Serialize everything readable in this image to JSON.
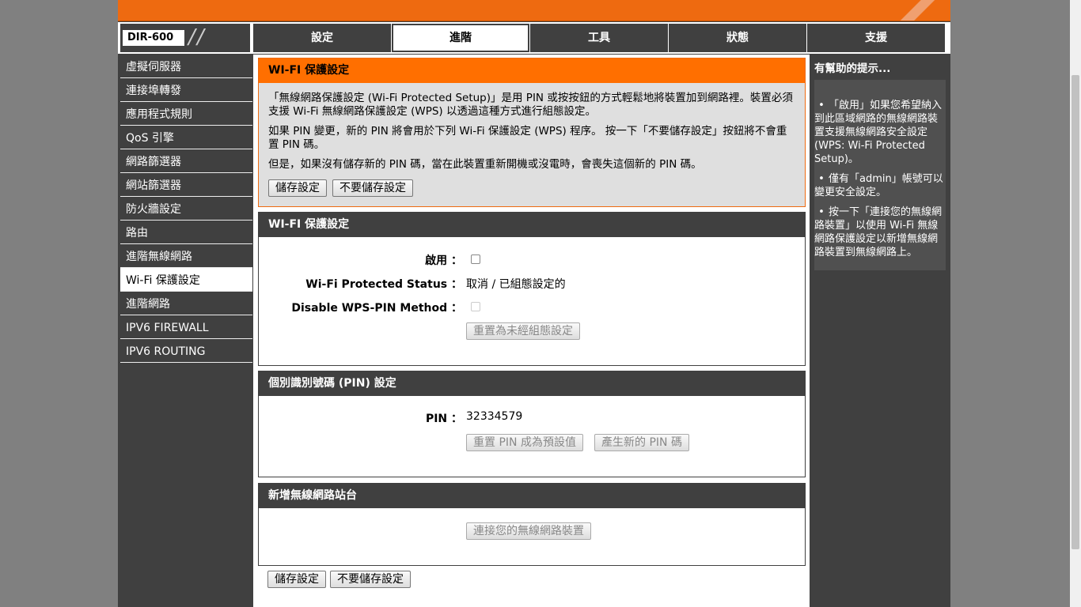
{
  "model": "DIR-600",
  "tabs": [
    {
      "label": "設定",
      "active": false
    },
    {
      "label": "進階",
      "active": true
    },
    {
      "label": "工具",
      "active": false
    },
    {
      "label": "狀態",
      "active": false
    },
    {
      "label": "支援",
      "active": false
    }
  ],
  "sidebar": {
    "items": [
      {
        "label": "虛擬伺服器"
      },
      {
        "label": "連接埠轉發"
      },
      {
        "label": "應用程式規則"
      },
      {
        "label": "QoS 引擎"
      },
      {
        "label": "網路篩選器"
      },
      {
        "label": "網站篩選器"
      },
      {
        "label": "防火牆設定"
      },
      {
        "label": "路由"
      },
      {
        "label": "進階無線網路"
      },
      {
        "label": "Wi-Fi 保護設定",
        "active": true
      },
      {
        "label": "進階網路"
      },
      {
        "label": "IPV6 FIREWALL"
      },
      {
        "label": "IPV6 ROUTING"
      }
    ]
  },
  "intro": {
    "title": "WI-FI 保護設定",
    "p1": "「無線網路保護設定 (Wi-Fi Protected Setup)」是用 PIN 或按按鈕的方式輕鬆地將裝置加到網路裡。裝置必須支援 Wi-Fi 無線網路保護設定 (WPS) 以透過這種方式進行組態設定。",
    "p2": "如果 PIN 變更，新的 PIN 將會用於下列 Wi-Fi 保護設定 (WPS) 程序。 按一下「不要儲存設定」按鈕將不會重置 PIN 碼。",
    "p3": "但是，如果沒有儲存新的 PIN 碼，當在此裝置重新開機或沒電時，會喪失這個新的 PIN 碼。",
    "save_label": "儲存設定",
    "dont_save_label": "不要儲存設定"
  },
  "wps": {
    "title": "WI-FI 保護設定",
    "enable_label": "啟用 ：",
    "enable_checked": false,
    "status_label": "Wi-Fi Protected Status ：",
    "status_value": "取消 / 已組態設定的",
    "disable_pin_label": "Disable WPS-PIN Method ：",
    "disable_pin_checked": false,
    "reset_unconfigured_label": "重置為未經組態設定"
  },
  "pin": {
    "title": "個別識別號碼 (PIN) 設定",
    "pin_label": "PIN ：",
    "pin_value": "32334579",
    "reset_default_label": "重置 PIN 成為預設值",
    "generate_label": "產生新的 PIN 碼"
  },
  "add_station": {
    "title": "新增無線網路站台",
    "connect_label": "連接您的無線網路裝置"
  },
  "bottom": {
    "save_label": "儲存設定",
    "dont_save_label": "不要儲存設定"
  },
  "hints": {
    "title": "有幫助的提示...",
    "items": [
      "「啟用」如果您希望納入到此區域網路的無線網路裝置支援無線網路安全設定 (WPS: Wi-Fi Protected Setup)。",
      "僅有「admin」帳號可以變更安全設定。",
      "按一下「連接您的無線網路裝置」以使用 Wi-Fi 無線網路保護設定以新增無線網路裝置到無線網路上。"
    ]
  },
  "colors": {
    "accent": "#ff6f00",
    "dark": "#404040",
    "page_bg": "#808080"
  }
}
